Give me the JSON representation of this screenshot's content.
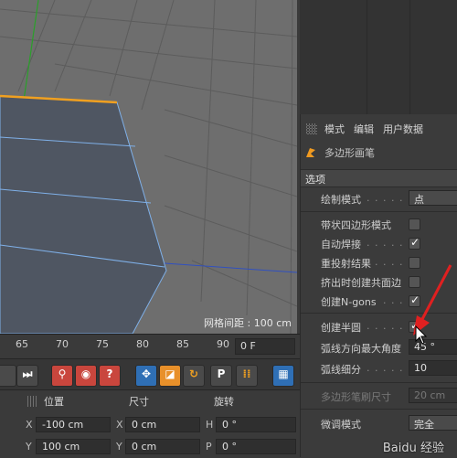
{
  "viewport": {
    "grid_spacing": "网格间距 : 100 cm"
  },
  "attributes": {
    "menu": [
      "模式",
      "编辑",
      "用户数据"
    ],
    "tool_name": "多边形画笔",
    "section": "选项",
    "draw_mode": {
      "label": "绘制模式",
      "value": "点"
    },
    "options": [
      {
        "label": "带状四边形模式",
        "checked": false
      },
      {
        "label": "自动焊接",
        "checked": true
      },
      {
        "label": "重投射结果",
        "checked": false
      },
      {
        "label": "挤出时创建共面边",
        "checked": false
      },
      {
        "label": "创建N-gons",
        "checked": true
      }
    ],
    "create_semicircle": {
      "label": "创建半圆",
      "checked": true
    },
    "arc_max_angle": {
      "label": "弧线方向最大角度",
      "value": "45 °"
    },
    "arc_subdivision": {
      "label": "弧线细分",
      "value": "10"
    },
    "brush_size": {
      "label": "多边形笔刷尺寸",
      "value": "20 cm"
    },
    "fine_tune": {
      "label": "微调模式",
      "value": "完全"
    }
  },
  "timeline": {
    "ticks": [
      "65",
      "70",
      "75",
      "80",
      "85",
      "90"
    ],
    "current_frame": "0 F"
  },
  "coords": {
    "headers": [
      "位置",
      "尺寸",
      "旋转"
    ],
    "rows": [
      {
        "pos_axis": "X",
        "pos": "-100 cm",
        "size_axis": "X",
        "size": "0 cm",
        "rot_axis": "H",
        "rot": "0 °"
      },
      {
        "pos_axis": "Y",
        "pos": "100 cm",
        "size_axis": "Y",
        "size": "0 cm",
        "rot_axis": "P",
        "rot": "0 °"
      }
    ]
  },
  "watermark": "Baidu 经验",
  "colors": {
    "selection_edge": "#f0a020",
    "viewport_bg": "#6e6e6e",
    "annotation_arrow": "#e02020"
  }
}
